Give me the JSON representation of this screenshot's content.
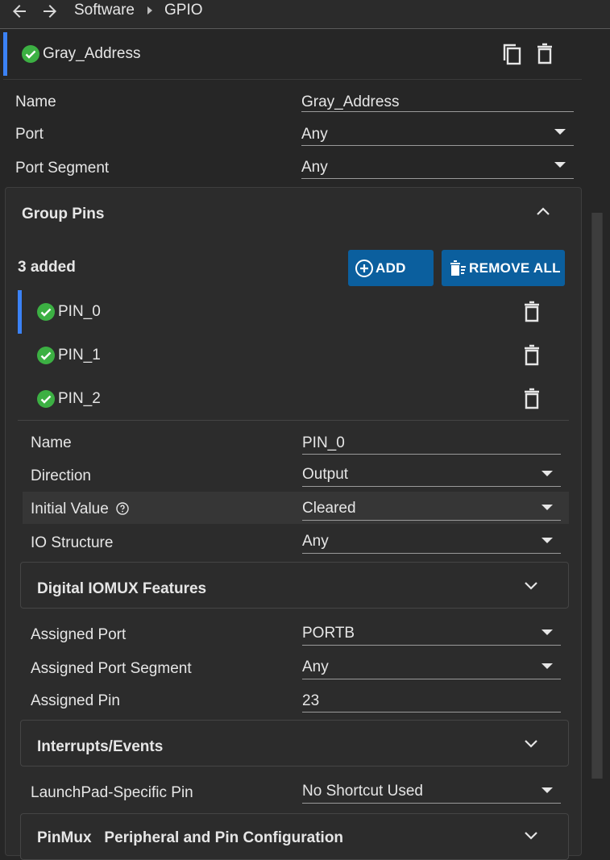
{
  "breadcrumb": {
    "root": "Software",
    "current": "GPIO"
  },
  "group": {
    "name": "Gray_Address"
  },
  "group_fields": [
    {
      "label": "Name",
      "value": "Gray_Address",
      "type": "text"
    },
    {
      "label": "Port",
      "value": "Any",
      "type": "select"
    },
    {
      "label": "Port Segment",
      "value": "Any",
      "type": "select"
    }
  ],
  "group_pins": {
    "title": "Group Pins",
    "count_text": "3 added",
    "add_label": "ADD",
    "remove_all_label": "REMOVE ALL",
    "pins": [
      "PIN_0",
      "PIN_1",
      "PIN_2"
    ]
  },
  "pin_fields": [
    {
      "label": "Name",
      "value": "PIN_0",
      "type": "text"
    },
    {
      "label": "Direction",
      "value": "Output",
      "type": "select"
    },
    {
      "label": "Initial Value",
      "value": "Cleared",
      "type": "select",
      "help": true
    },
    {
      "label": "IO Structure",
      "value": "Any",
      "type": "select"
    }
  ],
  "sections": {
    "digital": "Digital IOMUX Features",
    "interrupts": "Interrupts/Events",
    "pinmux": "PinMux   Peripheral and Pin Configuration"
  },
  "assigned_fields": [
    {
      "label": "Assigned Port",
      "value": "PORTB",
      "type": "select"
    },
    {
      "label": "Assigned Port Segment",
      "value": "Any",
      "type": "select"
    },
    {
      "label": "Assigned Pin",
      "value": "23",
      "type": "text"
    }
  ],
  "launchpad_field": {
    "label": "LaunchPad-Specific Pin",
    "value": "No Shortcut Used",
    "type": "select"
  },
  "colors": {
    "accent": "#3b82f6",
    "success": "#3cb043",
    "button": "#0b5f9e",
    "background": "#262626"
  },
  "icons": {
    "back": "arrow-left-icon",
    "forward": "arrow-right-icon",
    "copy": "copy-icon",
    "delete": "trash-icon",
    "check": "check-circle-icon",
    "add": "plus-circle-icon",
    "remove_all": "delete-sweep-icon",
    "collapse": "chevron-up-icon",
    "expand": "chevron-down-icon",
    "help": "help-circle-icon"
  }
}
